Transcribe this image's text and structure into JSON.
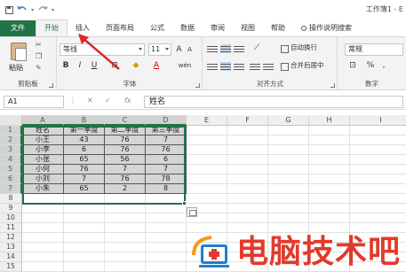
{
  "titlebar": {
    "title": "工作簿1 - E",
    "undo_icon": "undo-icon",
    "redo_icon": "redo-icon"
  },
  "tabs": [
    {
      "label": "文件"
    },
    {
      "label": "开始"
    },
    {
      "label": "插入"
    },
    {
      "label": "页面布局"
    },
    {
      "label": "公式"
    },
    {
      "label": "数据"
    },
    {
      "label": "审阅"
    },
    {
      "label": "视图"
    },
    {
      "label": "帮助"
    },
    {
      "label": "操作说明搜索"
    }
  ],
  "ribbon": {
    "clipboard": {
      "paste": "粘贴",
      "group": "剪贴板"
    },
    "font": {
      "name": "等线",
      "size": "11",
      "grow": "A",
      "shrink": "A",
      "bold": "B",
      "italic": "I",
      "underline": "U",
      "wen": "wén",
      "group": "字体"
    },
    "align": {
      "wrap": "自动换行",
      "merge": "合并后居中",
      "group": "对齐方式"
    },
    "number": {
      "format": "常规",
      "percent": "%",
      "comma": ",",
      "group": "数字"
    }
  },
  "formula_bar": {
    "cell_ref": "A1",
    "fx": "fx",
    "value": "姓名"
  },
  "columns": [
    "A",
    "B",
    "C",
    "D",
    "E",
    "F",
    "G",
    "H",
    "I"
  ],
  "rows": [
    "1",
    "2",
    "3",
    "4",
    "5",
    "6",
    "7",
    "8",
    "9",
    "10",
    "11",
    "12",
    "13",
    "14",
    "15"
  ],
  "table": [
    [
      "姓名",
      "第一季度",
      "第二季度",
      "第三季度"
    ],
    [
      "小王",
      "43",
      "76",
      "7"
    ],
    [
      "小李",
      "6",
      "76",
      "76"
    ],
    [
      "小张",
      "65",
      "56",
      "6"
    ],
    [
      "小何",
      "76",
      "7",
      "7"
    ],
    [
      "小刘",
      "7",
      "76",
      "78"
    ],
    [
      "小朱",
      "65",
      "2",
      "8"
    ]
  ],
  "watermark": {
    "text": "电脑技术吧"
  },
  "colors": {
    "excel_green": "#217346",
    "watermark_red": "#e23a2b",
    "arrow_red": "#d62b2b"
  }
}
